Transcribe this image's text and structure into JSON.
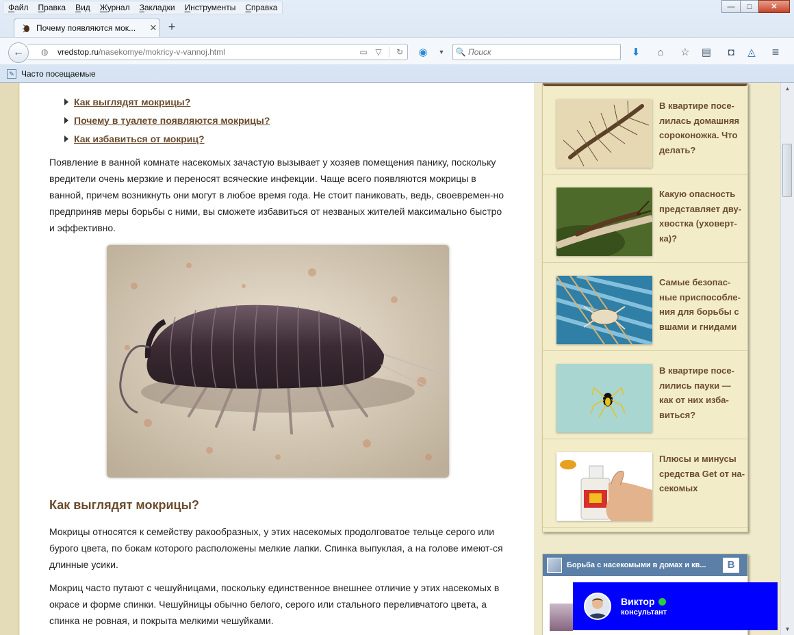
{
  "menu": [
    "Файл",
    "Правка",
    "Вид",
    "Журнал",
    "Закладки",
    "Инструменты",
    "Справка"
  ],
  "window": {
    "minimize": "—",
    "maximize": "□",
    "close": "✕"
  },
  "tab": {
    "title": "Почему появляются мок...",
    "close": "✕",
    "new_tab": "+"
  },
  "address": {
    "domain": "vredstop.ru",
    "path": "/nasekomye/mokricy-v-vannoj.html"
  },
  "search": {
    "placeholder": "Поиск"
  },
  "bookmarks": {
    "label": "Часто посещаемые"
  },
  "toc": [
    "Как выглядят мокрицы?",
    "Почему в туалете появляются мокрицы?",
    "Как избавиться от мокриц?"
  ],
  "article": {
    "intro": "Появление в ванной комнате насекомых зачастую вызывает у хозяев помещения панику, поскольку вредители очень мерзкие и переносят всяческие инфекции. Чаще всего появляются мокрицы в ванной, причем возникнуть они могут в любое время года. Не стоит паниковать, ведь, своевремен-но предприняв меры борьбы с ними, вы сможете избавиться от незваных жителей максимально быстро и эффективно.",
    "heading": "Как выглядят мокрицы?",
    "p2": "Мокрицы относятся к семейству ракообразных, у этих насекомых продолговатое тельце серого или бурого цвета, по бокам которого расположены мелкие лапки. Спинка выпуклая, а на голове имеют-ся длинные усики.",
    "p3": "Мокриц часто путают с чешуйницами, поскольку единственное внешнее отличие у этих насекомых в окрасе и форме спинки. Чешуйницы обычно белого, серого или стального переливчатого цвета, а спинка не ровная, и покрыта мелкими чешуйками."
  },
  "sidebar": [
    {
      "title": "В квартире посе-лилась домашняя сороконожка. Что делать?",
      "icon": "centipede-photo"
    },
    {
      "title": "Какую опасность представляет дву-хвостка (уховерт-ка)?",
      "icon": "earwig-photo"
    },
    {
      "title": "Самые безопас-ные приспособле-ния для борьбы с вшами и гнидами",
      "icon": "louse-photo"
    },
    {
      "title": "В квартире посе-лились пауки — как от них изба-виться?",
      "icon": "spider-photo"
    },
    {
      "title": "Плюсы и минусы средства Get от на-секомых",
      "icon": "get-bottle-photo"
    }
  ],
  "vk": {
    "title": "Борьба с насекомыми в домах и кв...",
    "logo": "B"
  },
  "chat": {
    "name": "Виктор",
    "role": "консультант"
  }
}
